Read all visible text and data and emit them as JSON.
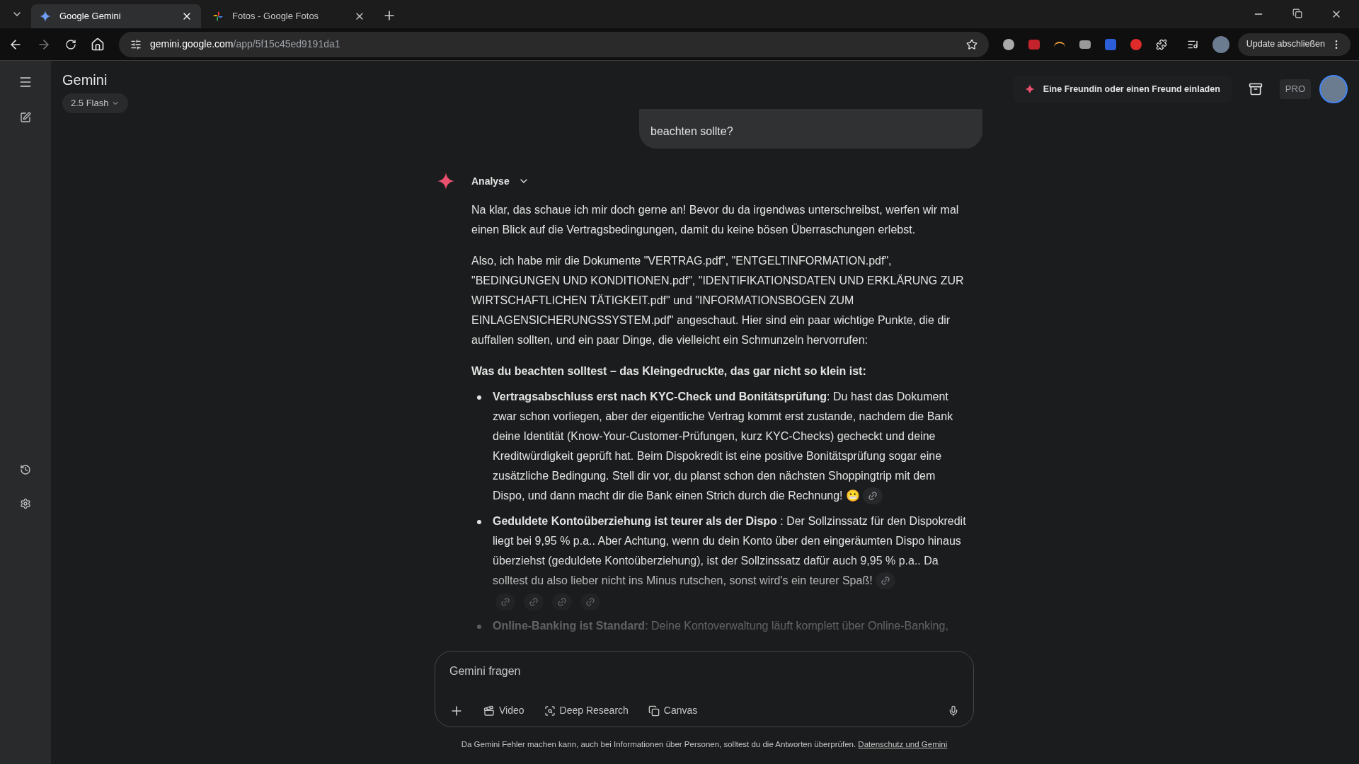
{
  "browser": {
    "tabs": [
      {
        "title": "Google Gemini",
        "kind": "gemini",
        "selected": true
      },
      {
        "title": "Fotos - Google Fotos",
        "kind": "photos",
        "selected": false
      }
    ],
    "url": {
      "host": "gemini.google.com",
      "path": "/app/5f15c45ed9191da1"
    },
    "update_button": "Update abschließen"
  },
  "app": {
    "title": "Gemini",
    "model": "2.5 Flash",
    "invite": "Eine Freundin oder einen Freund einladen",
    "plan": "PRO"
  },
  "chat": {
    "user_message": "beachten sollte?",
    "response": {
      "mode": "Analyse",
      "paragraphs": [
        "Na klar, das schaue ich mir doch gerne an! Bevor du da irgendwas unterschreibst, werfen wir mal einen Blick auf die Vertragsbedingungen, damit du keine bösen Überraschungen erlebst.",
        "Also, ich habe mir die Dokumente \"VERTRAG.pdf\", \"ENTGELTINFORMATION.pdf\", \"BEDINGUNGEN UND KONDITIONEN.pdf\", \"IDENTIFIKATIONSDATEN UND ERKLÄRUNG ZUR WIRTSCHAFTLICHEN TÄTIGKEIT.pdf\" und \"INFORMATIONSBOGEN ZUM EINLAGENSICHERUNGSSYSTEM.pdf\" angeschaut. Hier sind ein paar wichtige Punkte, die dir auffallen sollten, und ein paar Dinge, die vielleicht ein Schmunzeln hervorrufen:"
      ],
      "heading": "Was du beachten solltest – das Kleingedruckte, das gar nicht so klein ist:",
      "bullets": [
        {
          "text": "**Vertragsabschluss erst nach KYC-Check und Bonitätsprüfung**: Du hast das Dokument zwar schon vorliegen, aber der eigentliche Vertrag kommt erst zustande, nachdem die Bank deine Identität (Know-Your-Customer-Prüfungen, kurz KYC-Checks) gecheckt und deine Kreditwürdigkeit geprüft hat. Beim Dispokredit ist eine positive Bonitätsprüfung sogar eine zusätzliche Bedingung. Stell dir vor, du planst schon den nächsten Shoppingtrip mit dem Dispo, und dann macht dir die Bank einen Strich durch die Rechnung! 😬",
          "inline_link": true,
          "source_row": false
        },
        {
          "text": "**Geduldete Kontoüberziehung ist teurer als der Dispo** : Der Sollzinssatz für den Dispokredit liegt bei 9,95 % p.a.. Aber Achtung, wenn du dein Konto über den eingeräumten Dispo hinaus überziehst (geduldete Kontoüberziehung), ist der Sollzinssatz dafür auch 9,95 % p.a.. Da solltest du also lieber nicht ins Minus rutschen, sonst wird's ein teurer Spaß!",
          "inline_link": true,
          "source_row": true
        },
        {
          "text": "**Online-Banking ist Standard**: Deine Kontoverwaltung läuft komplett über Online-Banking,",
          "inline_link": false,
          "source_row": false
        }
      ]
    }
  },
  "input": {
    "placeholder": "Gemini fragen",
    "tools": [
      {
        "kind": "video",
        "label": "Video"
      },
      {
        "kind": "research",
        "label": "Deep Research"
      },
      {
        "kind": "canvas",
        "label": "Canvas"
      }
    ]
  },
  "footer": {
    "text": "Da Gemini Fehler machen kann, auch bei Informationen über Personen, solltest du die Antworten überprüfen.",
    "link": "Datenschutz und Gemini"
  }
}
